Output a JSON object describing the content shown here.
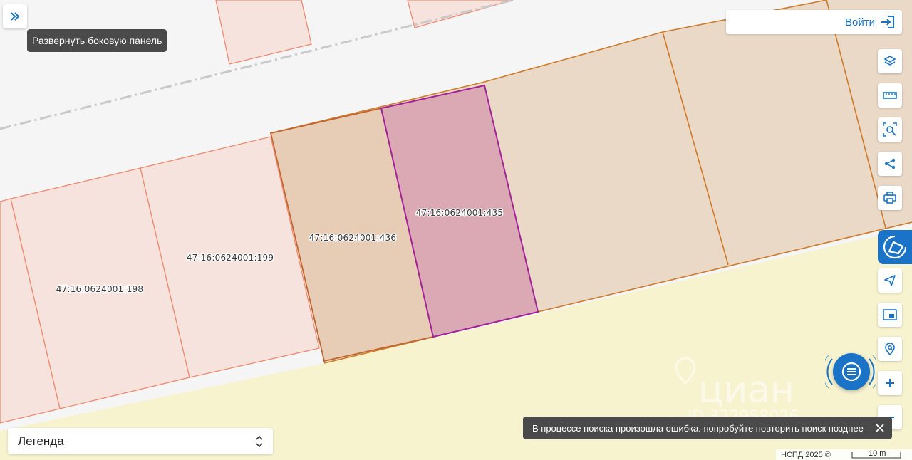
{
  "sidebar": {
    "expand_tooltip": "Развернуть боковую панель"
  },
  "header": {
    "login_label": "Войти"
  },
  "parcels": {
    "p198": "47:16:0624001:198",
    "p199": "47:16:0624001:199",
    "p436": "47:16:0624001:436",
    "p435": "47:16:0624001:435"
  },
  "watermark": {
    "brand": "циан",
    "id_text": "ID 322958026"
  },
  "legend": {
    "label": "Легенда"
  },
  "toast": {
    "message": "В процессе поиска произошла ошибка. попробуйте повторить поиск позднее"
  },
  "footer": {
    "attribution": "НСПД 2025 ©",
    "scale_label": "10 m"
  },
  "colors": {
    "accent": "#1a73c6",
    "selected_parcel_fill": "#dba9b4",
    "selected_parcel_stroke": "#a3249a",
    "orange_parcel_fill": "#e9d9c6",
    "light_parcel_fill": "#f7e3de",
    "yellow_area": "#f7f3cf"
  },
  "toolbar": {
    "icons": [
      "layers-icon",
      "ruler-icon",
      "area-search-icon",
      "share-icon",
      "print-icon",
      "draw-icon",
      "navigation-icon",
      "picture-in-picture-icon",
      "location-search-icon",
      "zoom-in-icon",
      "zoom-out-icon"
    ]
  }
}
